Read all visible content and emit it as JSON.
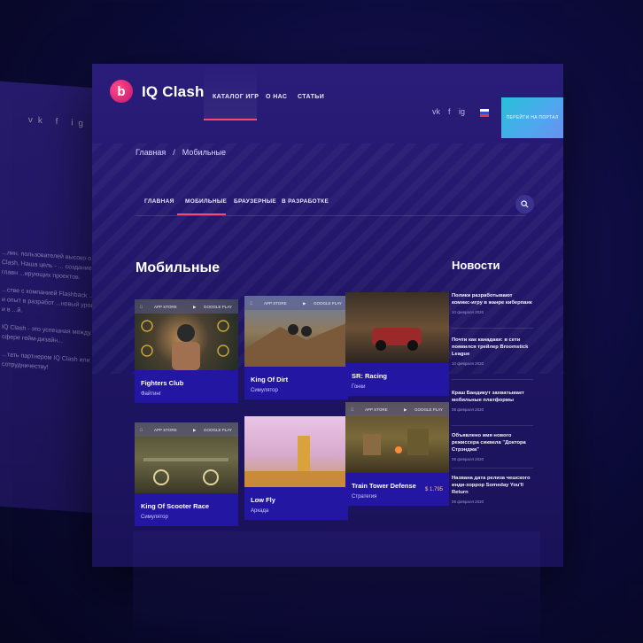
{
  "background_panel": {
    "social": [
      "vk",
      "f",
      "ig"
    ],
    "paragraphs": [
      "...лин. пользователей высоко о ... игры от IQ Clash. Наша цель - ... создание уникальных, а главн ...ирующих проектов.",
      "...стве с компанией Flashback ...е портфолио и опыт в разработ ...новый уровень развития и в ...й.",
      "IQ Clash - это успешная между... ...лашем в сфере гейм-дизайн...",
      "...тать партнером IQ Clash или р... ...крыты к сотрудничеству!"
    ]
  },
  "header": {
    "brand": "IQ Clash",
    "logo_letter": "b",
    "nav": [
      "КАТАЛОГ ИГР",
      "О НАС",
      "СТАТЬИ"
    ],
    "social": [
      "vk",
      "f",
      "ig"
    ],
    "cta": "ПЕРЕЙТИ НА ПОРТАЛ",
    "accent": "#ff4a6e"
  },
  "breadcrumb": {
    "home": "Главная",
    "separator": "/",
    "current": "Мобильные"
  },
  "tabs": [
    "ГЛАВНАЯ",
    "МОБИЛЬНЫЕ",
    "БРАУЗЕРНЫЕ",
    "В РАЗРАБОТКЕ"
  ],
  "section_title": "Мобильные",
  "store_labels": {
    "app_store": "APP STORE",
    "google_play": "GOOGLE PLAY"
  },
  "games": [
    {
      "name": "Fighters Club",
      "genre": "Файтинг",
      "price": ""
    },
    {
      "name": "King Of Dirt",
      "genre": "Симулятор",
      "price": ""
    },
    {
      "name": "SR: Racing",
      "genre": "Гонки",
      "price": ""
    },
    {
      "name": "King Of Scooter Race",
      "genre": "Симулятор",
      "price": ""
    },
    {
      "name": "Low Fly",
      "genre": "Аркада",
      "price": ""
    },
    {
      "name": "Train Tower Defense",
      "genre": "Стратегия",
      "price": "$ 1.795"
    }
  ],
  "news": {
    "title": "Новости",
    "items": [
      {
        "headline": "Полики разработывают комикс-игру в жанре киберпанк",
        "date": "10 февраля 2020"
      },
      {
        "headline": "Почти как канадаки: в сети появился трейлер Broomstick League",
        "date": "10 февраля 2020"
      },
      {
        "headline": "Краш Бандикут захватывает мобильные платформы",
        "date": "09 февраля 2020"
      },
      {
        "headline": "Объявлено имя нового режиссера сиквела \"Доктора Стрэнджа\"",
        "date": "09 февраля 2020"
      },
      {
        "headline": "Названа дата релиза чешского инди-хоррор Someday You'll Return",
        "date": "09 февраля 2020"
      }
    ]
  }
}
